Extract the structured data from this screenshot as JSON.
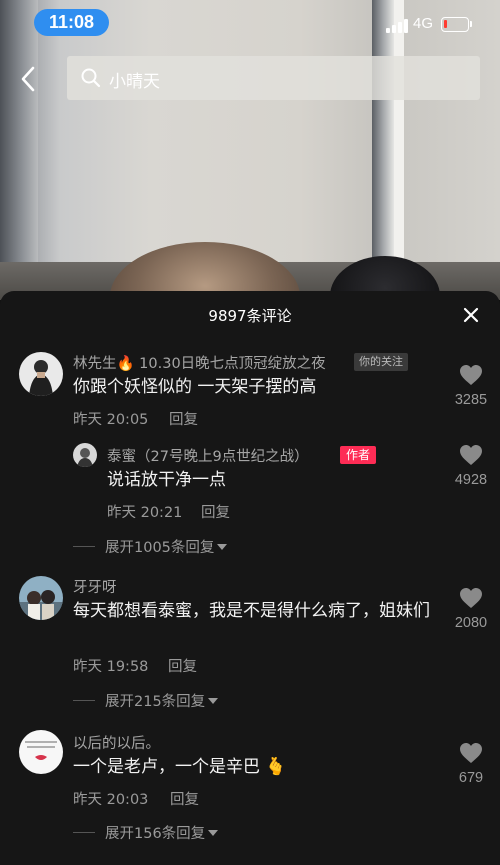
{
  "status_bar": {
    "time": "11:08",
    "network": "4G",
    "battery_level": 0.15,
    "battery_color": "#ff3b30",
    "time_pill_color": "#2f8ef0"
  },
  "search": {
    "query": "小晴天",
    "icon": "search-icon",
    "back_icon": "chevron-left-icon"
  },
  "comments_panel": {
    "title": "9897条评论",
    "close_icon": "close-icon",
    "comments": [
      {
        "username": "林先生🔥 10.30日晚七点顶冠绽放之夜",
        "badge": "你的关注",
        "text": "你跟个妖怪似的 一天架子摆的高",
        "time": "昨天 20:05",
        "reply_label": "回复",
        "likes": "3285",
        "replies": [
          {
            "username": "泰蜜（27号晚上9点世纪之战）",
            "badge": "作者",
            "badge_color": "#fe2c55",
            "text": "说话放干净一点",
            "time": "昨天 20:21",
            "reply_label": "回复",
            "likes": "4928"
          }
        ],
        "expand_label": "展开1005条回复"
      },
      {
        "username": "牙牙呀",
        "text": "每天都想看泰蜜，我是不是得什么病了，姐妹们",
        "time": "昨天 19:58",
        "reply_label": "回复",
        "likes": "2080",
        "expand_label": "展开215条回复"
      },
      {
        "username": "以后的以后。",
        "text": "一个是老卢，一个是辛巴 🫰",
        "time": "昨天 20:03",
        "reply_label": "回复",
        "likes": "679",
        "expand_label": "展开156条回复"
      }
    ]
  }
}
